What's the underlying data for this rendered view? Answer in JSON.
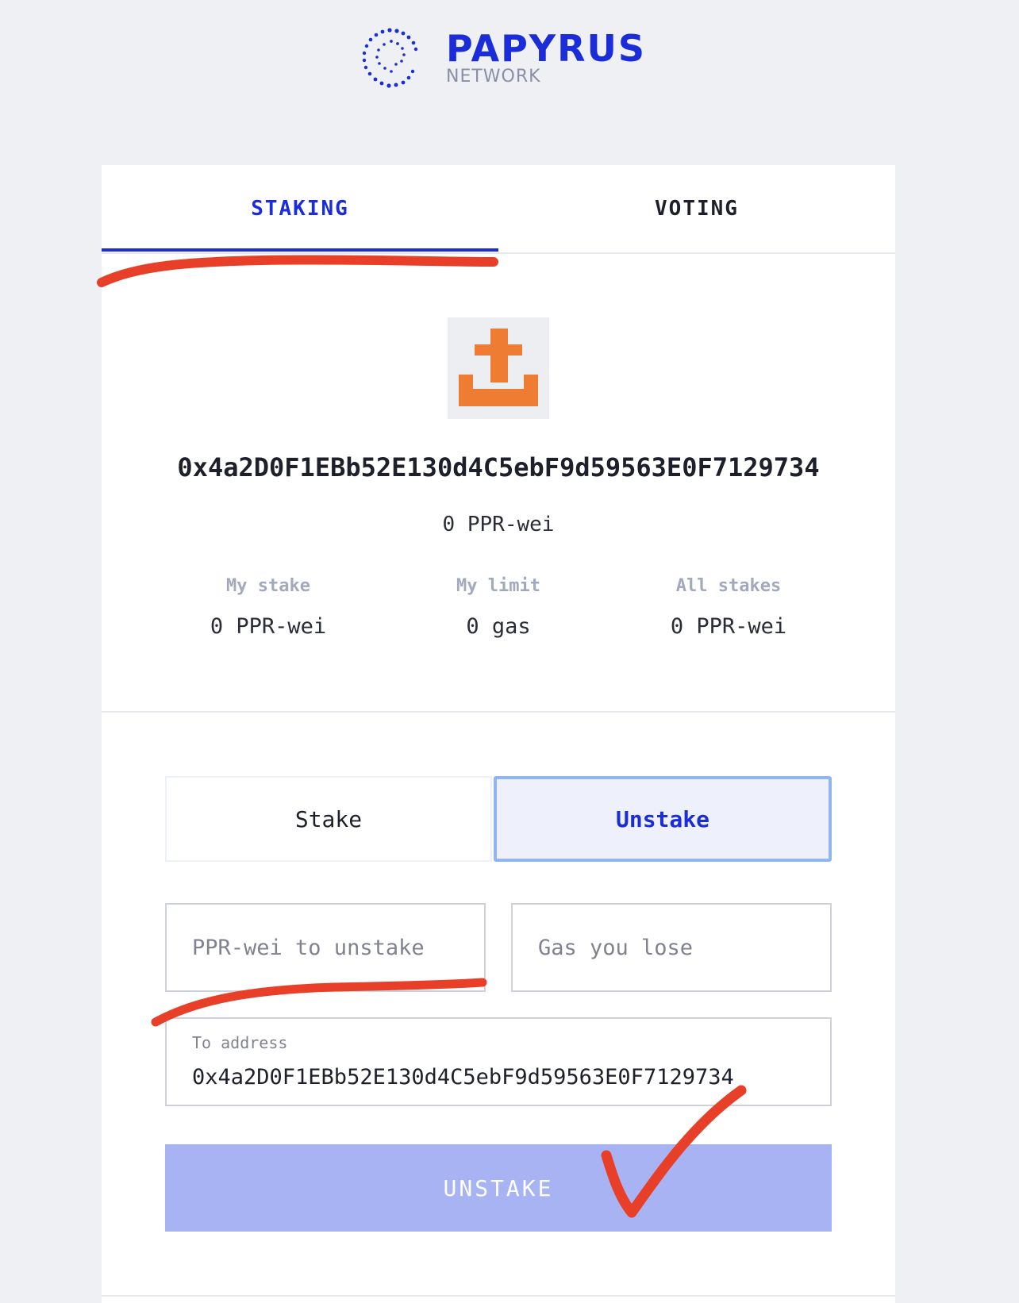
{
  "brand": {
    "name": "PAPYRUS",
    "subtitle": "NETWORK",
    "primary_color": "#1a2dd8"
  },
  "tabs": [
    {
      "label": "STAKING",
      "active": true
    },
    {
      "label": "VOTING",
      "active": false
    }
  ],
  "account": {
    "avatar_icon": "identicon-avatar",
    "address": "0x4a2D0F1EBb52E130d4C5ebF9d59563E0F7129734",
    "balance": "0 PPR-wei"
  },
  "stats": [
    {
      "label": "My stake",
      "value": "0 PPR-wei"
    },
    {
      "label": "My limit",
      "value": "0 gas"
    },
    {
      "label": "All stakes",
      "value": "0 PPR-wei"
    }
  ],
  "mode": {
    "stake_label": "Stake",
    "unstake_label": "Unstake",
    "selected": "Unstake"
  },
  "form": {
    "amount_placeholder": "PPR-wei to unstake",
    "gas_placeholder": "Gas you lose",
    "to_address_label": "To address",
    "to_address_value": "0x4a2D0F1EBb52E130d4C5ebF9d59563E0F7129734",
    "submit_label": "UNSTAKE"
  },
  "annotation_color": "#e84028"
}
